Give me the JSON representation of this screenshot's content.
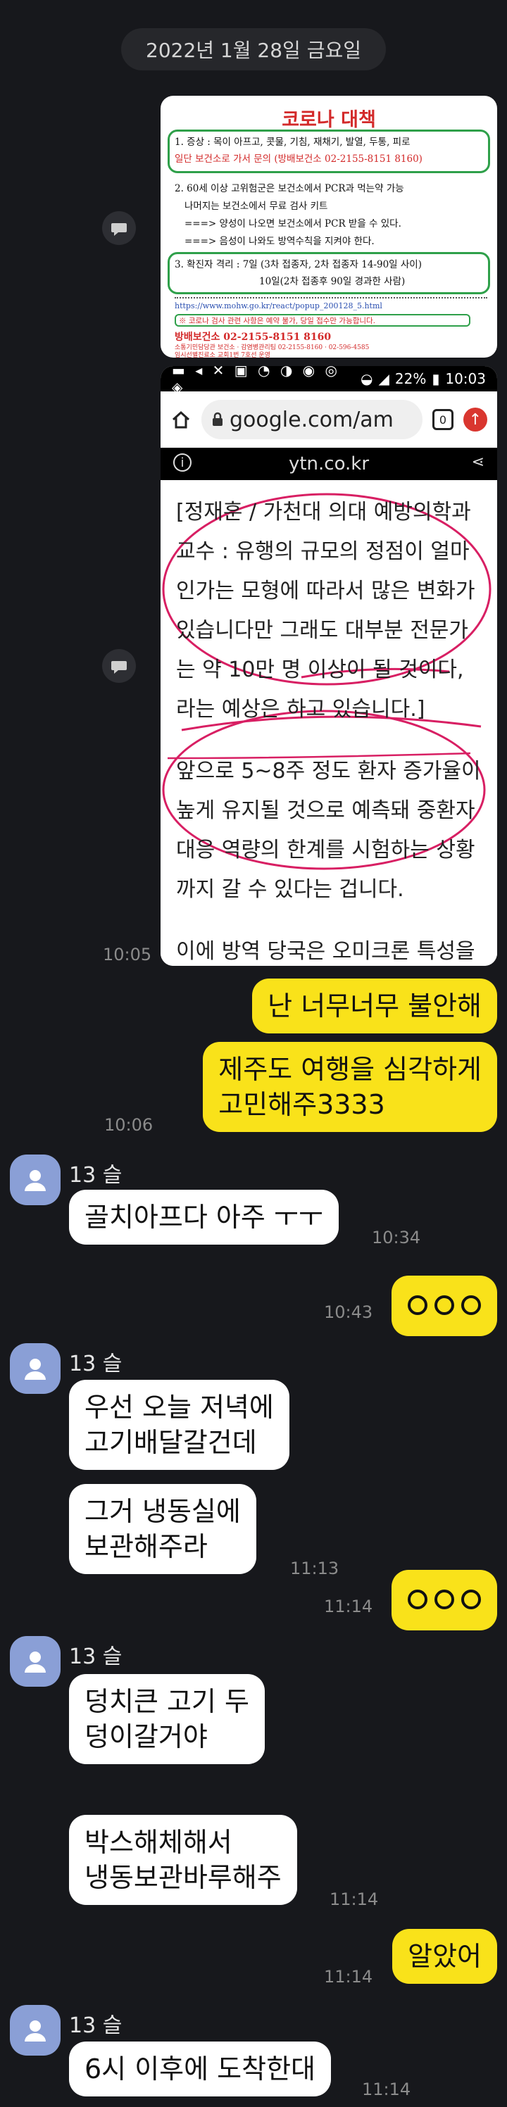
{
  "date_divider": "2022년 1월 28일 금요일",
  "notice_image": {
    "title": "코로나 대책",
    "line1a": "1. 증상 : 목이 아프고, 콧물, 기침, 재채기, 발열, 두통, 피로",
    "line1b": "일단 보건소로 가서 문의 (방배보건소 02-2155-8151 8160)",
    "line2a": "2. 60세 이상 고위험군은 보건소에서 PCR과 먹는약 가능",
    "line2b": "나머지는 보건소에서 무료 검사 키트",
    "line2c": "===> 양성이 나오면 보건소에서 PCR 받을 수 있다.",
    "line2d": "===> 음성이 나와도 방역수칙을 지켜야 한다.",
    "line3a": "3. 확진자 격리 : 7일 (3차 접종자, 2차 접종자 14-90일 사이)",
    "line3b": "10일(2차 접종후 90일 경과한 사람)",
    "url": "https://www.mohw.go.kr/react/popup_200128_5.html",
    "footer1": "※ 코로나 검사 관련 사항은 예약 불가, 당일 접수만 가능합니다.",
    "footer2": "방배보건소 02-2155-8151 8160",
    "footer3": "소통기민담당관 보건소 · 감염병관리팀 02-2155-8160 · 02-596-4585",
    "footer4": "임시선별진료소 교회1번 7호선 운영"
  },
  "screenshot_image": {
    "status_battery": "22%",
    "status_time": "10:03",
    "url": "google.com/am",
    "tab_count": "0",
    "site": "ytn.co.kr",
    "para1": [
      "[정재훈 / 가천대 의대 예방의학과",
      "교수 : 유행의 규모의 정점이 얼마",
      "인가는 모형에 따라서 많은 변화가",
      "있습니다만 그래도 대부분 전문가",
      "는 약 10만 명 이상이 될 것이다,",
      "라는 예상은 하고 있습니다.]"
    ],
    "para2": [
      "앞으로 5~8주 정도 환자 증가율이",
      "높게 유지될 것으로 예측돼 중환자",
      "대응 역량의 한계를 시험하는 상황",
      "까지 갈 수 있다는 겁니다."
    ],
    "para3": "이에 방역 당국은 오미크론 특성을"
  },
  "images_time": "10:05",
  "sender_name": "13 슬",
  "messages": {
    "m1": "난 너무너무 불안해",
    "m2a": "제주도 여행을 심각하게",
    "m2b": "고민해주3333",
    "m2_time": "10:06",
    "m3": "골치아프다 아주 ㅜㅜ",
    "m3_time": "10:34",
    "m4_time": "10:43",
    "m5a": "우선 오늘 저녁에",
    "m5b": "고기배달갈건데",
    "m6a": "그거 냉동실에",
    "m6b": "보관해주라",
    "m6_time": "11:13",
    "m7_time": "11:14",
    "m8a": "덩치큰 고기 두",
    "m8b": "덩이갈거야",
    "m9a": "박스해체해서",
    "m9b": "냉동보관바루해주",
    "m9_time": "11:14",
    "m10": "알았어",
    "m10_time": "11:14",
    "m11": "6시 이후에 도착한대",
    "m11_time": "11:14"
  },
  "colors": {
    "my_bubble": "#f9e21a",
    "their_bubble": "#ffffff",
    "background": "#17181c",
    "avatar": "#8a9fd6"
  }
}
